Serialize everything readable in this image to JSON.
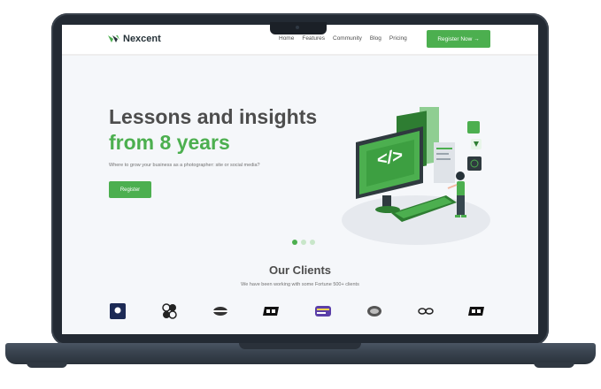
{
  "nav": {
    "brand": "Nexcent",
    "links": [
      "Home",
      "Features",
      "Community",
      "Blog",
      "Pricing"
    ],
    "cta": "Register Now →"
  },
  "hero": {
    "title_line1": "Lessons and insights",
    "title_line2": "from 8 years",
    "subtitle": "Where to grow your business as a photographer: site or social media?",
    "button": "Register",
    "carousel_active": 1,
    "carousel_count": 3
  },
  "clients": {
    "title": "Our Clients",
    "subtitle": "We have been working with some Fortune 500+ clients",
    "logo_icons": [
      "client-logo-1-icon",
      "client-logo-2-icon",
      "client-logo-3-icon",
      "client-logo-4-icon",
      "client-logo-5-icon",
      "client-logo-6-icon",
      "client-logo-7-icon",
      "client-logo-8-icon"
    ]
  },
  "colors": {
    "brand_green": "#4caf4f",
    "text_dark": "#4d4d4d",
    "laptop_frame": "#232a33"
  }
}
